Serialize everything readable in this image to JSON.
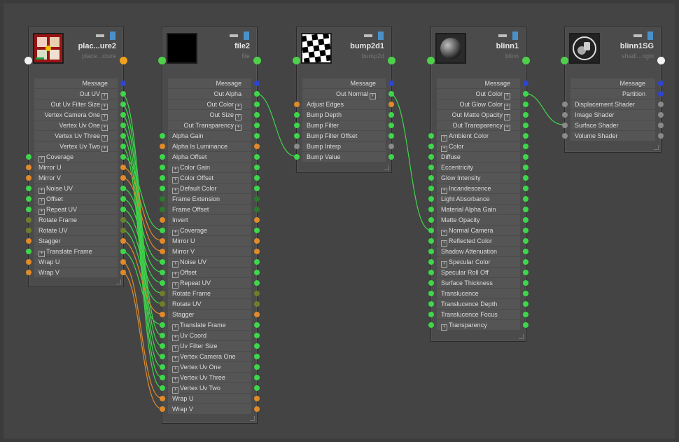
{
  "nodes": {
    "place": {
      "title": "plac...ure2",
      "subtitle": "place...xture",
      "thumbnail": "place2d-texture-icon",
      "outputs": [
        {
          "label": "Message",
          "exp": false,
          "color": "#2d45d0"
        },
        {
          "label": "Out UV",
          "exp": true,
          "color": "#3ed64a"
        },
        {
          "label": "Out Uv Filter Size",
          "exp": true,
          "color": "#3ed64a"
        },
        {
          "label": "Vertex Camera One",
          "exp": true,
          "color": "#3ed64a"
        },
        {
          "label": "Vertex Uv One",
          "exp": true,
          "color": "#3ed64a"
        },
        {
          "label": "Vertex Uv Three",
          "exp": true,
          "color": "#3ed64a"
        },
        {
          "label": "Vertex Uv Two",
          "exp": true,
          "color": "#3ed64a"
        }
      ],
      "inputs": [
        {
          "label": "Coverage",
          "exp": true,
          "color": "#3ed64a"
        },
        {
          "label": "Mirror U",
          "exp": false,
          "color": "#e08a2a"
        },
        {
          "label": "Mirror V",
          "exp": false,
          "color": "#e08a2a"
        },
        {
          "label": "Noise UV",
          "exp": true,
          "color": "#3ed64a"
        },
        {
          "label": "Offset",
          "exp": true,
          "color": "#3ed64a"
        },
        {
          "label": "Repeat UV",
          "exp": true,
          "color": "#3ed64a"
        },
        {
          "label": "Rotate Frame",
          "exp": false,
          "color": "#6e7f2c"
        },
        {
          "label": "Rotate UV",
          "exp": false,
          "color": "#6e7f2c"
        },
        {
          "label": "Stagger",
          "exp": false,
          "color": "#e08a2a"
        },
        {
          "label": "Translate Frame",
          "exp": true,
          "color": "#3ed64a"
        },
        {
          "label": "Wrap U",
          "exp": false,
          "color": "#e08a2a"
        },
        {
          "label": "Wrap V",
          "exp": false,
          "color": "#e08a2a"
        }
      ]
    },
    "file": {
      "title": "file2",
      "subtitle": "file",
      "thumbnail": "file-texture-icon",
      "outputs": [
        {
          "label": "Message",
          "exp": false,
          "color": "#2d45d0"
        },
        {
          "label": "Out Alpha",
          "exp": false,
          "color": "#3ed64a"
        },
        {
          "label": "Out Color",
          "exp": true,
          "color": "#3ed64a"
        },
        {
          "label": "Out Size",
          "exp": true,
          "color": "#3ed64a"
        },
        {
          "label": "Out Transparency",
          "exp": true,
          "color": "#3ed64a"
        }
      ],
      "inputs": [
        {
          "label": "Alpha Gain",
          "exp": false,
          "color": "#3ed64a"
        },
        {
          "label": "Alpha Is Luminance",
          "exp": false,
          "color": "#e08a2a"
        },
        {
          "label": "Alpha Offset",
          "exp": false,
          "color": "#3ed64a"
        },
        {
          "label": "Color Gain",
          "exp": true,
          "color": "#3ed64a"
        },
        {
          "label": "Color Offset",
          "exp": true,
          "color": "#3ed64a"
        },
        {
          "label": "Default Color",
          "exp": true,
          "color": "#3ed64a"
        },
        {
          "label": "Frame Extension",
          "exp": false,
          "color": "#2c7a2c"
        },
        {
          "label": "Frame Offset",
          "exp": false,
          "color": "#2c7a2c"
        },
        {
          "label": "Invert",
          "exp": false,
          "color": "#e08a2a"
        },
        {
          "label": "Coverage",
          "exp": true,
          "color": "#3ed64a"
        },
        {
          "label": "Mirror U",
          "exp": false,
          "color": "#e08a2a"
        },
        {
          "label": "Mirror V",
          "exp": false,
          "color": "#e08a2a"
        },
        {
          "label": "Noise UV",
          "exp": true,
          "color": "#3ed64a"
        },
        {
          "label": "Offset",
          "exp": true,
          "color": "#3ed64a"
        },
        {
          "label": "Repeat UV",
          "exp": true,
          "color": "#3ed64a"
        },
        {
          "label": "Rotate Frame",
          "exp": false,
          "color": "#6e7f2c"
        },
        {
          "label": "Rotate UV",
          "exp": false,
          "color": "#6e7f2c"
        },
        {
          "label": "Stagger",
          "exp": false,
          "color": "#e08a2a"
        },
        {
          "label": "Translate Frame",
          "exp": true,
          "color": "#3ed64a"
        },
        {
          "label": "Uv Coord",
          "exp": true,
          "color": "#3ed64a"
        },
        {
          "label": "Uv Filter Size",
          "exp": true,
          "color": "#3ed64a"
        },
        {
          "label": "Vertex Camera One",
          "exp": true,
          "color": "#3ed64a"
        },
        {
          "label": "Vertex Uv One",
          "exp": true,
          "color": "#3ed64a"
        },
        {
          "label": "Vertex Uv Three",
          "exp": true,
          "color": "#3ed64a"
        },
        {
          "label": "Vertex Uv Two",
          "exp": true,
          "color": "#3ed64a"
        },
        {
          "label": "Wrap U",
          "exp": false,
          "color": "#e08a2a"
        },
        {
          "label": "Wrap V",
          "exp": false,
          "color": "#e08a2a"
        }
      ]
    },
    "bump": {
      "title": "bump2d1",
      "subtitle": "bump2d",
      "thumbnail": "checker-bump-icon",
      "outputs": [
        {
          "label": "Message",
          "exp": false,
          "color": "#2d45d0"
        },
        {
          "label": "Out Normal",
          "exp": true,
          "color": "#3ed64a"
        }
      ],
      "inputs": [
        {
          "label": "Adjust Edges",
          "exp": false,
          "color": "#e08a2a"
        },
        {
          "label": "Bump Depth",
          "exp": false,
          "color": "#3ed64a"
        },
        {
          "label": "Bump Filter",
          "exp": false,
          "color": "#3ed64a"
        },
        {
          "label": "Bump Filter Offset",
          "exp": false,
          "color": "#3ed64a"
        },
        {
          "label": "Bump Interp",
          "exp": false,
          "color": "#8a8a8a"
        },
        {
          "label": "Bump Value",
          "exp": false,
          "color": "#3ed64a"
        }
      ]
    },
    "blinn": {
      "title": "blinn1",
      "subtitle": "blinn",
      "thumbnail": "blinn-sphere-icon",
      "outputs": [
        {
          "label": "Message",
          "exp": false,
          "color": "#2d45d0"
        },
        {
          "label": "Out Color",
          "exp": true,
          "color": "#3ed64a"
        },
        {
          "label": "Out Glow Color",
          "exp": true,
          "color": "#3ed64a"
        },
        {
          "label": "Out Matte Opacity",
          "exp": true,
          "color": "#3ed64a"
        },
        {
          "label": "Out Transparency",
          "exp": true,
          "color": "#3ed64a"
        }
      ],
      "inputs": [
        {
          "label": "Ambient Color",
          "exp": true,
          "color": "#3ed64a"
        },
        {
          "label": "Color",
          "exp": true,
          "color": "#3ed64a"
        },
        {
          "label": "Diffuse",
          "exp": false,
          "color": "#3ed64a"
        },
        {
          "label": "Eccentricity",
          "exp": false,
          "color": "#3ed64a"
        },
        {
          "label": "Glow Intensity",
          "exp": false,
          "color": "#3ed64a"
        },
        {
          "label": "Incandescence",
          "exp": true,
          "color": "#3ed64a"
        },
        {
          "label": "Light Absorbance",
          "exp": false,
          "color": "#3ed64a"
        },
        {
          "label": "Material Alpha Gain",
          "exp": false,
          "color": "#3ed64a"
        },
        {
          "label": "Matte Opacity",
          "exp": false,
          "color": "#3ed64a"
        },
        {
          "label": "Normal Camera",
          "exp": true,
          "color": "#3ed64a"
        },
        {
          "label": "Reflected Color",
          "exp": true,
          "color": "#3ed64a"
        },
        {
          "label": "Shadow Attenuation",
          "exp": false,
          "color": "#3ed64a"
        },
        {
          "label": "Specular Color",
          "exp": true,
          "color": "#3ed64a"
        },
        {
          "label": "Specular Roll Off",
          "exp": false,
          "color": "#3ed64a"
        },
        {
          "label": "Surface Thickness",
          "exp": false,
          "color": "#3ed64a"
        },
        {
          "label": "Translucence",
          "exp": false,
          "color": "#3ed64a"
        },
        {
          "label": "Translucence Depth",
          "exp": false,
          "color": "#3ed64a"
        },
        {
          "label": "Translucence Focus",
          "exp": false,
          "color": "#3ed64a"
        },
        {
          "label": "Transparency",
          "exp": true,
          "color": "#3ed64a"
        }
      ]
    },
    "sg": {
      "title": "blinn1SG",
      "subtitle": "shadi...ngin",
      "thumbnail": "shading-group-icon",
      "outputs": [
        {
          "label": "Message",
          "exp": false,
          "color": "#2d45d0"
        },
        {
          "label": "Partition",
          "exp": false,
          "color": "#2d45d0"
        }
      ],
      "inputs": [
        {
          "label": "Displacement Shader",
          "exp": false,
          "color": "#8a8a8a"
        },
        {
          "label": "Image Shader",
          "exp": false,
          "color": "#8a8a8a"
        },
        {
          "label": "Surface Shader",
          "exp": false,
          "color": "#8a8a8a"
        },
        {
          "label": "Volume Shader",
          "exp": false,
          "color": "#8a8a8a"
        }
      ]
    }
  },
  "colors": {
    "background": "#444444",
    "node": "#4b4b4b",
    "row": "#555555",
    "wire_green": "#3ed64a",
    "wire_orange": "#e08a2a",
    "message": "#2d45d0"
  }
}
